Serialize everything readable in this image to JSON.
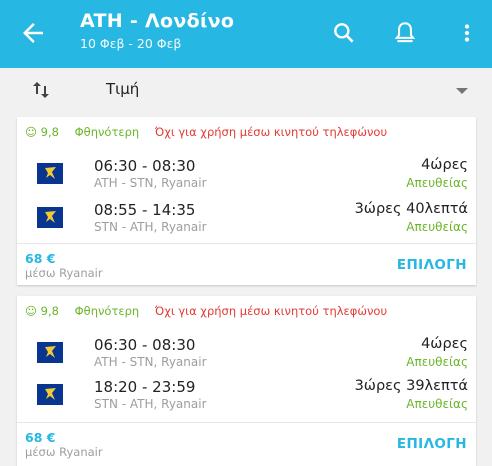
{
  "header": {
    "title": "ATH - Λονδίνο",
    "subtitle": "10 Φεβ - 20 Φεβ",
    "bg_color": "#27b7e3",
    "icons": [
      "back-arrow-icon",
      "search-icon",
      "bell-icon",
      "more-vert-icon"
    ]
  },
  "sort": {
    "icon": "swap-vert-icon",
    "label": "Τιμή",
    "dropdown_icon": "caret-down-icon"
  },
  "results": [
    {
      "score": "9,8",
      "cheapest_label": "Φθηνότερη",
      "warning": "Όχι για χρήση μέσω κινητού τηλεφώνου",
      "flights": [
        {
          "time": "06:30 - 08:30",
          "route": "ATH - STN, Ryanair",
          "duration": "4ώρες",
          "stops": "Απευθείας"
        },
        {
          "time": "08:55 - 14:35",
          "route": "STN - ATH, Ryanair",
          "duration": "3ώρες 40λεπτά",
          "stops": "Απευθείας"
        }
      ],
      "price": "68 €",
      "via": "μέσω Ryanair",
      "select_label": "ΕΠΙΛΟΓΗ"
    },
    {
      "score": "9,8",
      "cheapest_label": "Φθηνότερη",
      "warning": "Όχι για χρήση μέσω κινητού τηλεφώνου",
      "flights": [
        {
          "time": "06:30 - 08:30",
          "route": "ATH - STN, Ryanair",
          "duration": "4ώρες",
          "stops": "Απευθείας"
        },
        {
          "time": "18:20 - 23:59",
          "route": "STN - ATH, Ryanair",
          "duration": "3ώρες 39λεπτά",
          "stops": "Απευθείας"
        }
      ],
      "price": "68 €",
      "via": "μέσω Ryanair",
      "select_label": "ΕΠΙΛΟΓΗ"
    }
  ],
  "colors": {
    "accent": "#27b7e3",
    "green": "#6bb52a",
    "warning_red": "#e53935",
    "airline_blue": "#073590",
    "airline_yellow": "#f1c933"
  }
}
